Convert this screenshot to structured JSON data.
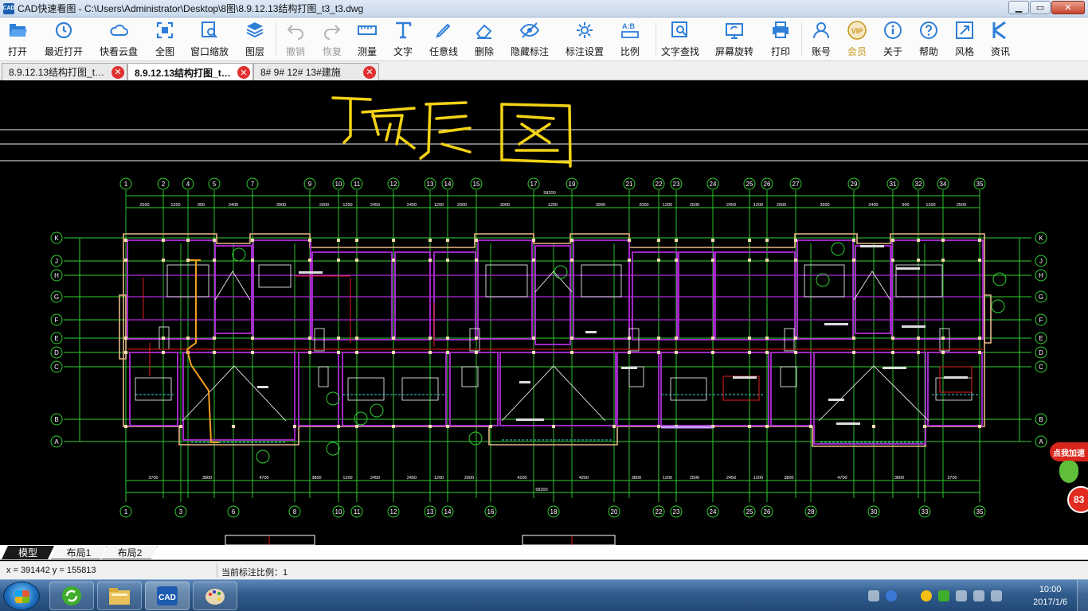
{
  "window": {
    "icon_text": "CAD",
    "title": "CAD快速看图 - C:\\Users\\Administrator\\Desktop\\8图\\8.9.12.13结构打图_t3_t3.dwg",
    "minimize": "▁",
    "maximize": "▭",
    "close": "✕"
  },
  "toolbar": [
    {
      "label": "打开",
      "icon": "folder-open-icon"
    },
    {
      "label": "最近打开",
      "icon": "recent-clock-icon"
    },
    {
      "label": "快看云盘",
      "icon": "cloud-icon"
    },
    {
      "label": "全图",
      "icon": "full-extent-icon"
    },
    {
      "label": "窗口缩放",
      "icon": "window-zoom-icon"
    },
    {
      "label": "图层",
      "icon": "layers-icon"
    },
    {
      "label": "撤销",
      "icon": "undo-icon",
      "disabled": true
    },
    {
      "label": "恢复",
      "icon": "redo-icon",
      "disabled": true
    },
    {
      "label": "测量",
      "icon": "ruler-icon"
    },
    {
      "label": "文字",
      "icon": "text-icon"
    },
    {
      "label": "任意线",
      "icon": "pen-icon"
    },
    {
      "label": "删除",
      "icon": "eraser-icon"
    },
    {
      "label": "隐藏标注",
      "icon": "eye-hide-icon"
    },
    {
      "label": "标注设置",
      "icon": "gear-icon"
    },
    {
      "label": "比例",
      "icon": "scale-icon"
    },
    {
      "label": "文字查找",
      "icon": "text-search-icon"
    },
    {
      "label": "屏幕旋转",
      "icon": "screen-rotate-icon"
    },
    {
      "label": "打印",
      "icon": "printer-icon"
    },
    {
      "label": "账号",
      "icon": "user-icon"
    },
    {
      "label": "会员",
      "icon": "vip-icon",
      "vip": true
    },
    {
      "label": "关于",
      "icon": "info-icon"
    },
    {
      "label": "帮助",
      "icon": "help-icon"
    },
    {
      "label": "风格",
      "icon": "style-icon"
    },
    {
      "label": "资讯",
      "icon": "news-icon"
    }
  ],
  "tabs": [
    {
      "label": "8.9.12.13结构打图_t…",
      "active": false
    },
    {
      "label": "8.9.12.13结构打图_t…",
      "active": true
    },
    {
      "label": "8# 9# 12# 13#建施",
      "active": false
    }
  ],
  "tab_close": "✕",
  "drawing": {
    "handwritten_title": "顶层图",
    "top_axis_labels": [
      "1",
      "2",
      "4",
      "5",
      "7",
      "9",
      "10",
      "11",
      "12",
      "13",
      "14",
      "15",
      "17",
      "19",
      "21",
      "22",
      "23",
      "24",
      "25",
      "26",
      "27",
      "29",
      "31",
      "32",
      "34",
      "35"
    ],
    "bottom_axis_labels": [
      "1",
      "3",
      "6",
      "8",
      "10",
      "11",
      "12",
      "13",
      "14",
      "16",
      "18",
      "20",
      "22",
      "23",
      "24",
      "25",
      "26",
      "28",
      "30",
      "33",
      "35"
    ],
    "row_axis_labels": [
      "K",
      "J",
      "H",
      "G",
      "F",
      "E",
      "D",
      "C",
      "B",
      "A"
    ],
    "top_dims": [
      "2500",
      "1200",
      "900",
      "2400",
      "3900",
      "2000",
      "1200",
      "2450",
      "2450",
      "1200",
      "2000",
      "3900",
      "1200",
      "3900",
      "2000",
      "1200",
      "2500",
      "2450",
      "1200",
      "2000",
      "3900",
      "2400",
      "900",
      "1200",
      "2500"
    ],
    "bottom_dims": [
      "3700",
      "3800",
      "4700",
      "3800",
      "1200",
      "2450",
      "2450",
      "1200",
      "2000",
      "4200",
      "4200",
      "3800",
      "1200",
      "2500",
      "2450",
      "1200",
      "3800",
      "4700",
      "3800",
      "3700"
    ],
    "overall_dim": "58200"
  },
  "side_widget": {
    "badge": "点我加速",
    "count": "83"
  },
  "layout_tabs": [
    {
      "label": "模型",
      "active": true
    },
    {
      "label": "布局1",
      "active": false
    },
    {
      "label": "布局2",
      "active": false
    }
  ],
  "status": {
    "coords": "x = 391442  y = 155813",
    "scale": "当前标注比例：1"
  },
  "taskbar": {
    "cad_label": "CAD",
    "time": "10:00",
    "date": "2017/1/6"
  },
  "colors": {
    "grid_green": "#2fd12f",
    "wall_magenta": "#b12bd9",
    "beam_orange": "#e7b98a",
    "annotation_red": "#e02020",
    "handwriting_yellow": "#f3d215",
    "taskbar_blue": "#2f5b8c"
  }
}
